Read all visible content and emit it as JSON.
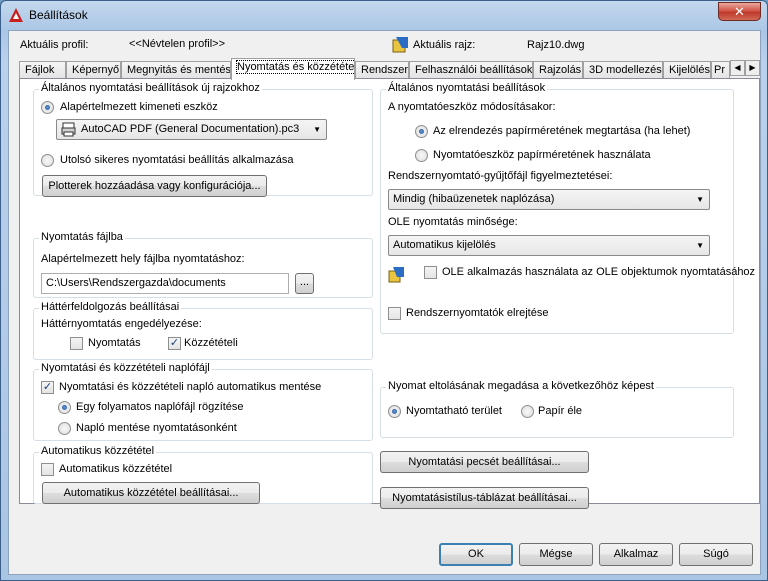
{
  "window": {
    "title": "Beállítások",
    "close": "✕"
  },
  "profile": {
    "label": "Aktuális profil:",
    "value": "<<Névtelen profil>>"
  },
  "drawing": {
    "label": "Aktuális rajz:",
    "value": "Rajz10.dwg"
  },
  "tabs": [
    "Fájlok",
    "Képernyő",
    "Megnyitás és mentés",
    "Nyomtatás és közzététel",
    "Rendszer",
    "Felhasználói beállítások",
    "Rajzolás",
    "3D modellezés",
    "Kijelölés",
    "Pr"
  ],
  "tab_scroll": {
    "left": "◀",
    "right": "▶"
  },
  "new_drawing_group": {
    "title": "Általános nyomtatási beállítások új rajzokhoz",
    "default_output": "Alapértelmezett kimeneti eszköz",
    "device": "AutoCAD PDF (General Documentation).pc3",
    "last_successful": "Utolsó sikeres nyomtatási beállítás alkalmazása",
    "plotter_button": "Plotterek hozzáadása vagy konfigurációja..."
  },
  "plot_to_file": {
    "title": "Nyomtatás fájlba",
    "label": "Alapértelmezett hely fájlba nyomtatáshoz:",
    "path": "C:\\Users\\Rendszergazda\\documents",
    "browse": "..."
  },
  "background": {
    "title": "Háttérfeldolgozás beállításai",
    "enable_label": "Háttérnyomtatás engedélyezése:",
    "plotting": "Nyomtatás",
    "publishing": "Közzétételi",
    "plotting_checked": false,
    "publishing_checked": true
  },
  "log": {
    "title": "Nyomtatási és közzétételi naplófájl",
    "auto_save": "Nyomtatási és közzétételi napló automatikus mentése",
    "continuous": "Egy folyamatos naplófájl rögzítése",
    "per_plot": "Napló mentése nyomtatásonként"
  },
  "auto_publish": {
    "title": "Automatikus közzététel",
    "checkbox": "Automatikus közzététel",
    "button": "Automatikus közzététel beállításai..."
  },
  "general_options": {
    "title": "Általános nyomtatási beállítások",
    "when_changing": "A nyomtatóeszköz módosításakor:",
    "keep_layout": "Az elrendezés papírméretének megtartása (ha lehet)",
    "use_device": "Nyomtatóeszköz papírméretének használata",
    "spooler_label": "Rendszernyomtató-gyűjtőfájl figyelmeztetései:",
    "spooler_value": "Mindig (hibaüzenetek naplózása)",
    "ole_label": "OLE nyomtatás minősége:",
    "ole_value": "Automatikus kijelölés",
    "ole_app": "OLE alkalmazás használata az OLE objektumok nyomtatásához",
    "hide_system": "Rendszernyomtatók elrejtése",
    "check_mark": "✓"
  },
  "offset": {
    "title": "Nyomat eltolásának megadása a következőhöz képest",
    "printable": "Nyomtatható terület",
    "paper_edge": "Papír éle"
  },
  "stamp_button": "Nyomtatási pecsét beállításai...",
  "style_button": "Nyomtatásistílus-táblázat beállításai...",
  "footer": {
    "ok": "OK",
    "cancel": "Mégse",
    "apply": "Alkalmaz",
    "help": "Súgó"
  }
}
